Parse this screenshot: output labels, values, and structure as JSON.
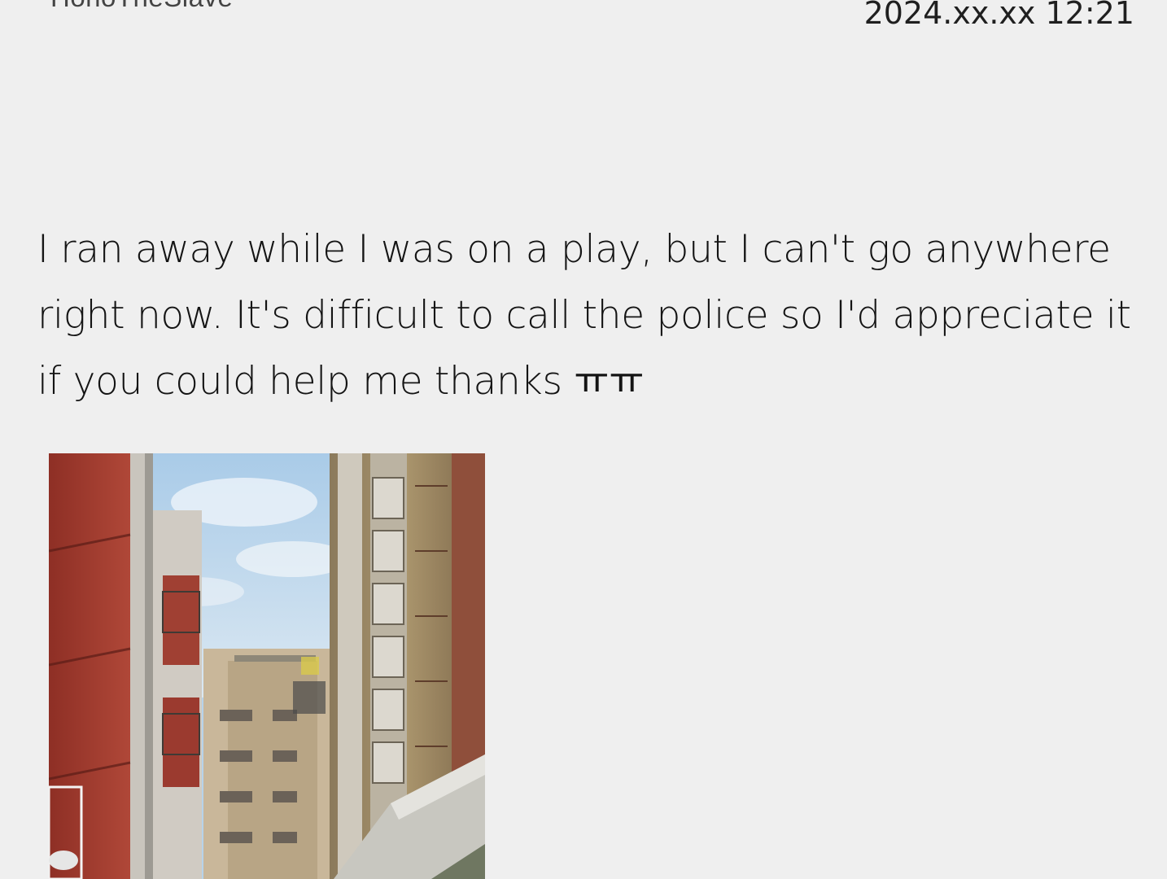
{
  "post": {
    "username": "HonoTheSlave",
    "timestamp": "2024.xx.xx 12:21",
    "message": "I ran away while I was on a play, but I can't go anywhere right now. It's difficult to call the police so I'd appreciate it if you could help me thanks ㅠㅠ",
    "photo": {
      "subject": "alley-between-buildings-photo"
    }
  }
}
